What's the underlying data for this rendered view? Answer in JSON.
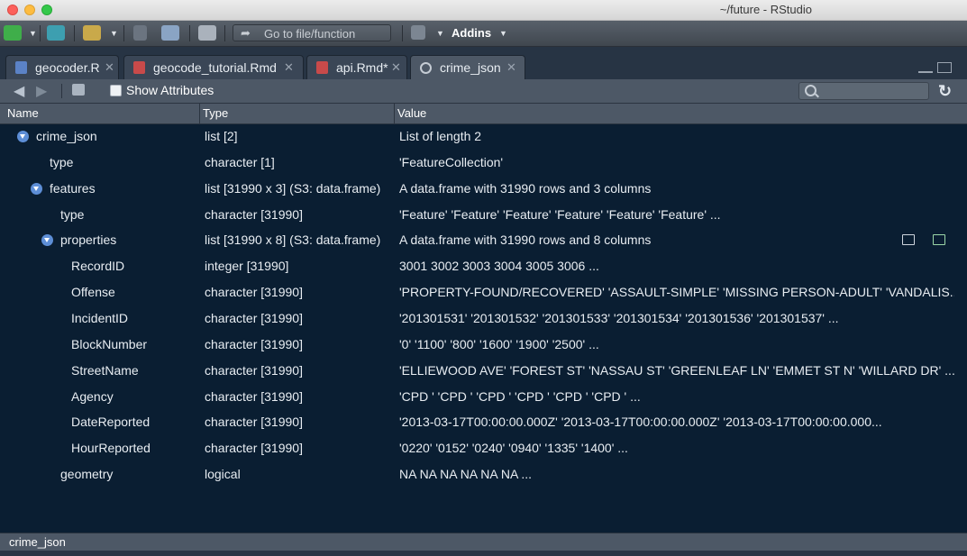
{
  "window": {
    "title": "~/future - RStudio"
  },
  "toolbar": {
    "goto_placeholder": "Go to file/function",
    "addins_label": "Addins",
    "icons": [
      "new-file-icon",
      "new-project-icon",
      "open-file-icon",
      "save-icon",
      "save-all-icon",
      "print-icon",
      "grid-layout-icon"
    ]
  },
  "tabs": [
    {
      "label": "geocoder.R",
      "icon": "r-file-icon",
      "active": false
    },
    {
      "label": "geocode_tutorial.Rmd",
      "icon": "rmd-file-icon",
      "active": false
    },
    {
      "label": "api.Rmd*",
      "icon": "rmd-file-icon",
      "active": false,
      "modified": true
    },
    {
      "label": "crime_json",
      "icon": "data-viewer-icon",
      "active": true
    }
  ],
  "viewbar": {
    "show_attributes_label": "Show Attributes",
    "show_attributes_checked": false
  },
  "columns": {
    "name": "Name",
    "type": "Type",
    "value": "Value"
  },
  "rows": [
    {
      "name": "crime_json",
      "type": "list [2]",
      "value": "List of length 2",
      "level": 0,
      "expandable": true
    },
    {
      "name": "type",
      "type": "character [1]",
      "value": "'FeatureCollection'",
      "level": 1,
      "expandable": false
    },
    {
      "name": "features",
      "type": "list [31990 x 3] (S3: data.frame)",
      "value": "A data.frame with 31990 rows and 3 columns",
      "level": 1,
      "expandable": true
    },
    {
      "name": "type",
      "type": "character [31990]",
      "value": "'Feature' 'Feature' 'Feature' 'Feature' 'Feature' 'Feature' ...",
      "level": 2,
      "expandable": false
    },
    {
      "name": "properties",
      "type": "list [31990 x 8] (S3: data.frame)",
      "value": "A data.frame with 31990 rows and 8 columns",
      "level": 2,
      "expandable": true
    },
    {
      "name": "RecordID",
      "type": "integer [31990]",
      "value": "3001 3002 3003 3004 3005 3006 ...",
      "level": 3,
      "expandable": false
    },
    {
      "name": "Offense",
      "type": "character [31990]",
      "value": "'PROPERTY-FOUND/RECOVERED' 'ASSAULT-SIMPLE' 'MISSING PERSON-ADULT' 'VANDALIS...",
      "level": 3,
      "expandable": false
    },
    {
      "name": "IncidentID",
      "type": "character [31990]",
      "value": "'201301531' '201301532' '201301533' '201301534' '201301536' '201301537' ...",
      "level": 3,
      "expandable": false
    },
    {
      "name": "BlockNumber",
      "type": "character [31990]",
      "value": "'0' '1100' '800' '1600' '1900' '2500' ...",
      "level": 3,
      "expandable": false
    },
    {
      "name": "StreetName",
      "type": "character [31990]",
      "value": "'ELLIEWOOD AVE' 'FOREST ST' 'NASSAU ST' 'GREENLEAF LN' 'EMMET ST N' 'WILLARD DR' ...",
      "level": 3,
      "expandable": false
    },
    {
      "name": "Agency",
      "type": "character [31990]",
      "value": "'CPD ' 'CPD ' 'CPD ' 'CPD ' 'CPD ' 'CPD ' ...",
      "level": 3,
      "expandable": false
    },
    {
      "name": "DateReported",
      "type": "character [31990]",
      "value": "'2013-03-17T00:00:00.000Z' '2013-03-17T00:00:00.000Z' '2013-03-17T00:00:00.000...",
      "level": 3,
      "expandable": false
    },
    {
      "name": "HourReported",
      "type": "character [31990]",
      "value": "'0220' '0152' '0240' '0940' '1335' '1400' ...",
      "level": 3,
      "expandable": false
    },
    {
      "name": "geometry",
      "type": "logical",
      "value": "NA NA NA NA NA NA ...",
      "level": 2,
      "expandable": false
    }
  ],
  "row_action_icons": [
    "view-table-icon",
    "add-to-code-icon"
  ],
  "status": {
    "text": "crime_json"
  },
  "colors": {
    "background": "#0a1e32",
    "panel": "#4d5866",
    "accent": "#5d8ed6"
  }
}
